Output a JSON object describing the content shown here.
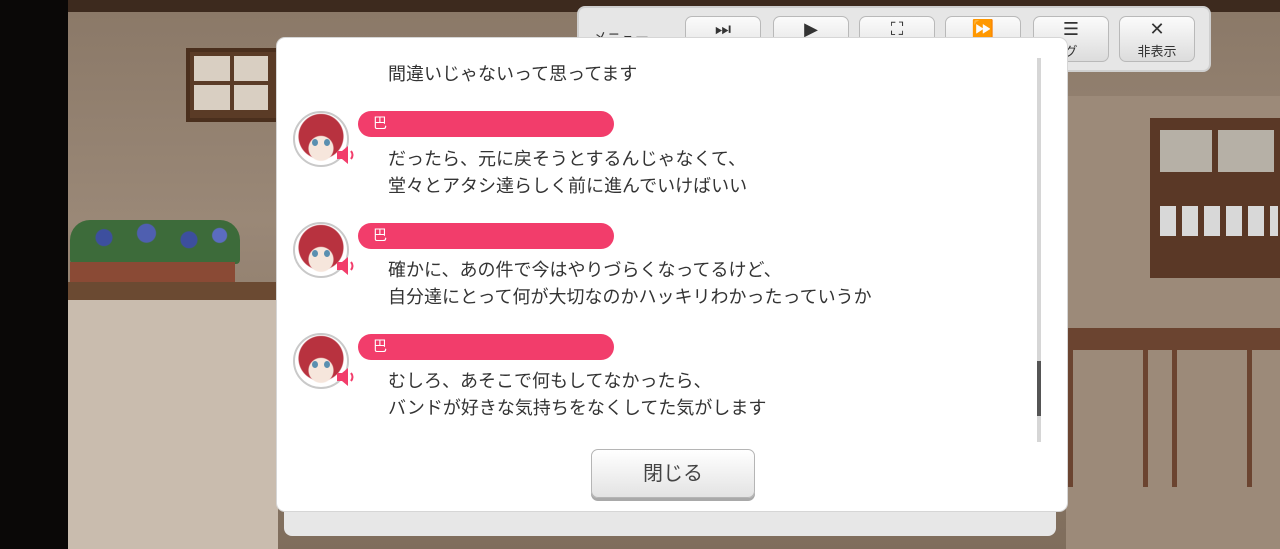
{
  "menu": {
    "label": "メニュー",
    "buttons": [
      {
        "icon": "skip-icon",
        "glyph": "⏭",
        "label": ""
      },
      {
        "icon": "play-icon",
        "glyph": "▶",
        "label": ""
      },
      {
        "icon": "auto-icon",
        "glyph": "⛶",
        "label": ""
      },
      {
        "icon": "fast-forward-icon",
        "glyph": "⏩",
        "label": ""
      },
      {
        "icon": "log-icon",
        "glyph": "☰",
        "label": "グ"
      },
      {
        "icon": "close-x-icon",
        "glyph": "✕",
        "label": "非表示"
      }
    ]
  },
  "log": {
    "entries": [
      {
        "speaker": "",
        "lines": [
          "間違いじゃないって思ってます"
        ]
      },
      {
        "speaker": "巴",
        "lines": [
          "だったら、元に戻そうとするんじゃなくて、",
          "堂々とアタシ達らしく前に進んでいけばいい"
        ]
      },
      {
        "speaker": "巴",
        "lines": [
          "確かに、あの件で今はやりづらくなってるけど、",
          "自分達にとって何が大切なのかハッキリわかったっていうか"
        ]
      },
      {
        "speaker": "巴",
        "lines": [
          "むしろ、あそこで何もしてなかったら、",
          "バンドが好きな気持ちをなくしてた気がします"
        ]
      }
    ]
  },
  "close_button": {
    "label": "閉じる"
  },
  "colors": {
    "name_bar": "#f23d6b",
    "dialog_bg": "#ffffff",
    "text": "#333333"
  }
}
